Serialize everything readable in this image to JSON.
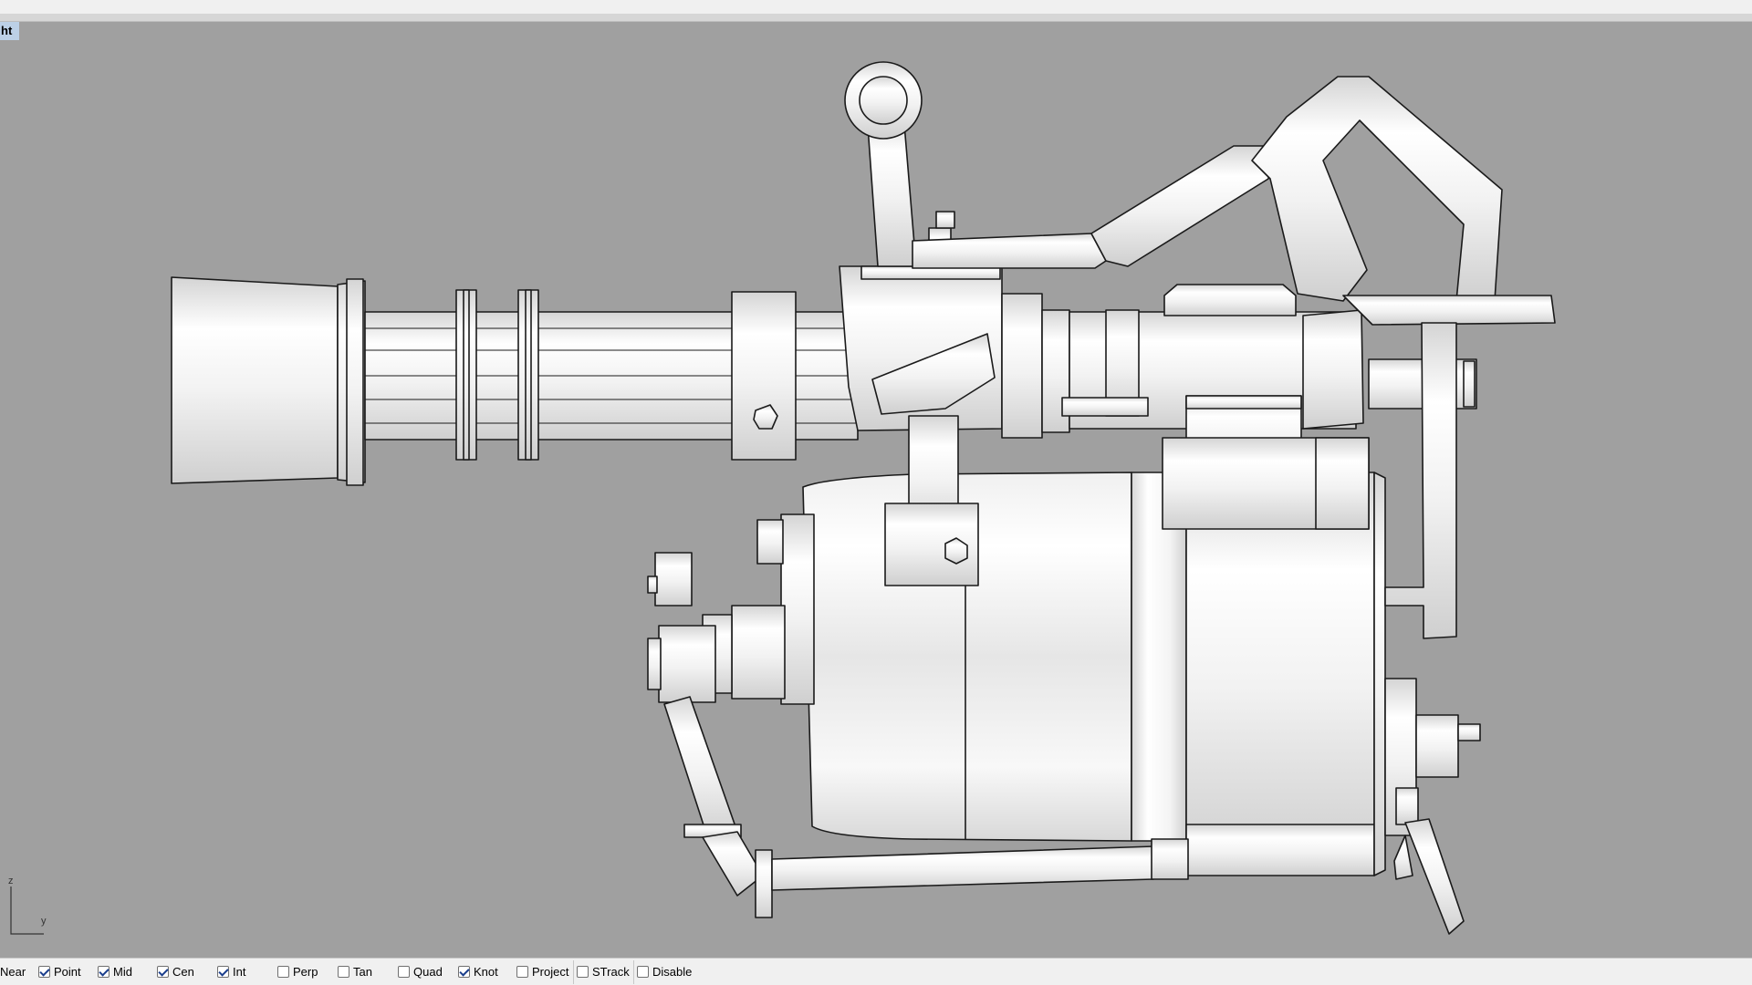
{
  "viewport": {
    "title": "ht",
    "background": "#a0a0a0",
    "axes": {
      "z": "z",
      "y": "y"
    }
  },
  "osnap": [
    {
      "label": "Near",
      "checked": null
    },
    {
      "label": "Point",
      "checked": true
    },
    {
      "label": "Mid",
      "checked": true
    },
    {
      "label": "Cen",
      "checked": true
    },
    {
      "label": "Int",
      "checked": true
    },
    {
      "label": "Perp",
      "checked": false
    },
    {
      "label": "Tan",
      "checked": false
    },
    {
      "label": "Quad",
      "checked": false
    },
    {
      "label": "Knot",
      "checked": true
    },
    {
      "label": "Project",
      "checked": false
    },
    {
      "label": "STrack",
      "checked": false
    },
    {
      "label": "Disable",
      "checked": false
    }
  ]
}
